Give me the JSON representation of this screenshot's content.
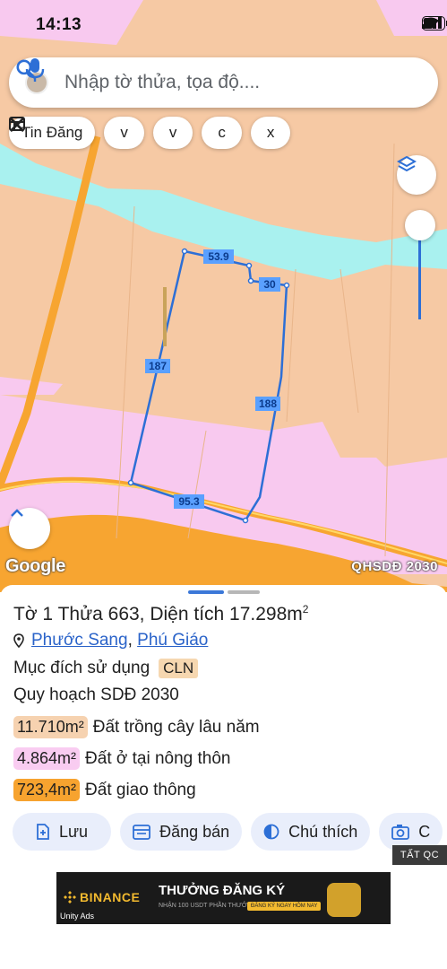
{
  "status_bar": {
    "time": "14:13"
  },
  "search": {
    "placeholder": "Nhập tờ thửa, tọa độ...."
  },
  "chips": [
    {
      "label": "Tin Đăng",
      "icon": "news-icon"
    },
    {
      "label": "v",
      "icon": "tools-icon"
    },
    {
      "label": "v",
      "icon": "tools-icon"
    },
    {
      "label": "c",
      "icon": "tools-icon"
    },
    {
      "label": "x",
      "icon": "tools-icon"
    }
  ],
  "map": {
    "edge_labels": [
      "53.9",
      "30",
      "187",
      "188",
      "95.3"
    ],
    "attribution": "Google",
    "plan_label": "QHSDĐ 2030",
    "colors": {
      "land": "#f6c9a4",
      "residential": "#f8c9ef",
      "water": "#a9f1ef",
      "road": "#f7a531",
      "boundary": "#2d6fd6"
    }
  },
  "parcel": {
    "title": "Tờ 1 Thửa 663, Diện tích 17.298m",
    "title_sup": "2",
    "ward": "Phước Sang",
    "district": "Phú Giáo",
    "separator": ",",
    "purpose_label": "Mục đích sử dụng",
    "purpose_code": "CLN",
    "plan_label": "Quy hoạch SDĐ 2030"
  },
  "zones": [
    {
      "value": "11.710m²",
      "label": "Đất trồng cây lâu năm",
      "color": "#f6d2b0"
    },
    {
      "value": "4.864m²",
      "label": "Đất ở tại nông thôn",
      "color": "#f9ccf1"
    },
    {
      "value": "723,4m²",
      "label": "Đất giao thông",
      "color": "#f7a32f"
    }
  ],
  "actions": [
    {
      "label": "Lưu",
      "icon": "save-icon"
    },
    {
      "label": "Đăng bán",
      "icon": "calendar-icon"
    },
    {
      "label": "Chú thích",
      "icon": "legend-icon"
    },
    {
      "label": "C",
      "icon": "camera-icon"
    }
  ],
  "ad": {
    "close_label": "TẤT QC",
    "brand": "BINANCE",
    "headline": "THƯỞNG ĐĂNG KÝ",
    "sub": "NHẬN 100 USDT PHẦN THƯỞNG",
    "cta": "ĐĂNG KÝ NGAY HÔM NAY",
    "sdk": "Unity Ads"
  }
}
